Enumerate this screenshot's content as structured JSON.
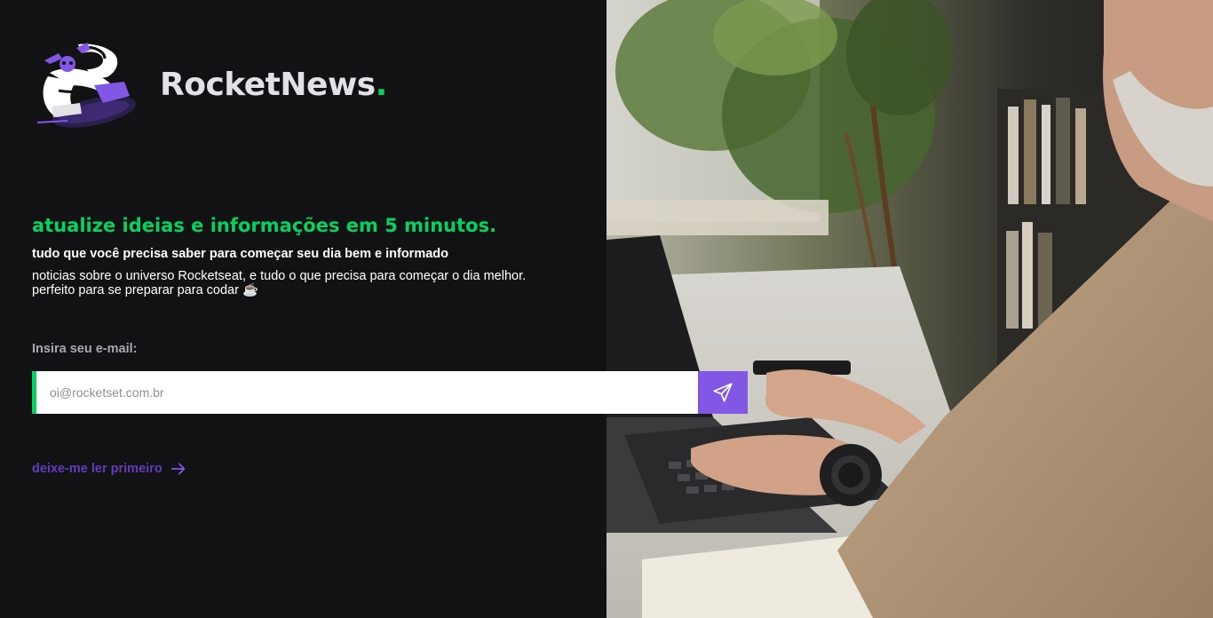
{
  "brand": {
    "name": "RocketNews",
    "dot": ".",
    "logo_icon": "astronaut-reading-newspaper-icon",
    "accent_color": "#04d361"
  },
  "hero": {
    "headline": "atualize ideias e informações em 5 minutos.",
    "subheadline": "tudo que você precisa saber para começar seu dia bem e informado",
    "description": "noticias sobre o universo Rocketseat, e tudo o que precisa para começar o dia melhor. perfeito para se preparar para codar ☕"
  },
  "form": {
    "label": "Insira seu e-mail:",
    "placeholder": "oi@rocketset.com.br",
    "value": "",
    "submit_icon": "send-icon",
    "button_color": "#8257e5"
  },
  "read_first": {
    "label": "deixe-me ler primeiro",
    "icon": "arrow-right-icon",
    "color": "#633bbc"
  },
  "photo": {
    "subject": "man-typing-on-laptop-photo"
  }
}
